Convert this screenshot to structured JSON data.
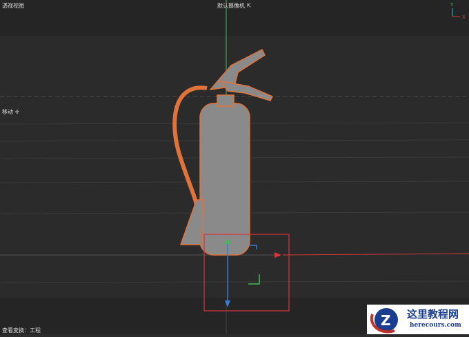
{
  "viewport": {
    "view_name": "透视视图",
    "camera_label": "默认摄像机",
    "camera_icon": "camera-link-icon",
    "tool_label": "移动",
    "tool_icon": "move-icon",
    "status": "查看变换：工程"
  },
  "axis_gizmo": {
    "y": "Y",
    "x": "X"
  },
  "watermark": {
    "title": "这里教程网",
    "url": "herecours.com"
  },
  "colors": {
    "x_axis": "#d83b3b",
    "y_axis": "#3fbf5a",
    "z_axis": "#3a7bd5",
    "selection": "#e0733a",
    "box": "#d8343a"
  }
}
